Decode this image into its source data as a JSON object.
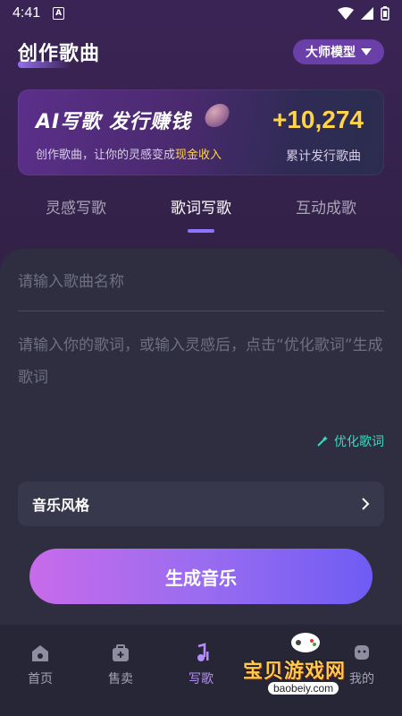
{
  "status": {
    "time": "4:41",
    "a_badge": "A"
  },
  "header": {
    "title": "创作歌曲",
    "model_label": "大师模型"
  },
  "banner": {
    "title": "AI写歌 发行赚钱",
    "subtitle_prefix": "创作歌曲，让你的灵感变成",
    "subtitle_highlight": "现金收入",
    "amount": "+10,274",
    "amount_label": "累计发行歌曲"
  },
  "tabs": [
    {
      "label": "灵感写歌"
    },
    {
      "label": "歌词写歌"
    },
    {
      "label": "互动成歌"
    }
  ],
  "active_tab": 1,
  "form": {
    "song_name_placeholder": "请输入歌曲名称",
    "lyrics_placeholder": "请输入你的歌词，或输入灵感后，点击“优化歌词”生成歌词",
    "optimize_label": "优化歌词",
    "style_label": "音乐风格",
    "generate_label": "生成音乐"
  },
  "nav": [
    {
      "label": "首页",
      "icon": "home-icon"
    },
    {
      "label": "售卖",
      "icon": "shop-icon"
    },
    {
      "label": "写歌",
      "icon": "music-note-icon"
    },
    {
      "label": "",
      "icon": ""
    },
    {
      "label": "我的",
      "icon": "profile-icon"
    }
  ],
  "watermark": {
    "text": "宝贝游戏网",
    "url": "baobeiy.com"
  },
  "colors": {
    "accent": "#8b74ff",
    "gold": "#ffd34a",
    "teal": "#3fd7c0"
  }
}
